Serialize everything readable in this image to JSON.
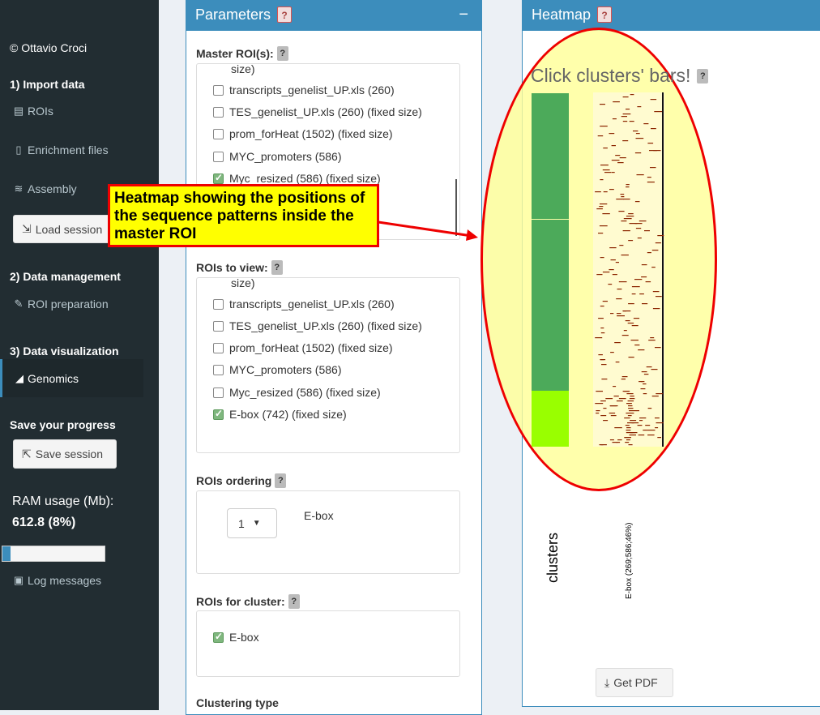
{
  "sidebar": {
    "copyright": "© Ottavio Croci",
    "section_import": "1) Import data",
    "item_rois": "ROIs",
    "item_enrichment": "Enrichment files",
    "item_assembly": "Assembly",
    "load_session": "Load session",
    "section_management": "2) Data management",
    "item_roi_preparation": "ROI preparation",
    "section_visualization": "3) Data visualization",
    "item_genomics": "Genomics",
    "save_progress": "Save your progress",
    "save_session": "Save session",
    "ram_label": "RAM usage (Mb):",
    "ram_value": "612.8 (8%)",
    "ram_percent": 8,
    "log_messages": "Log messages"
  },
  "parameters": {
    "title": "Parameters",
    "help": "?",
    "collapse": "−",
    "master_label": "Master ROI(s):",
    "master_cut": "size)",
    "master_items": [
      {
        "label": "transcripts_genelist_UP.xls (260)",
        "checked": false
      },
      {
        "label": "TES_genelist_UP.xls (260) (fixed size)",
        "checked": false
      },
      {
        "label": "prom_forHeat (1502) (fixed size)",
        "checked": false
      },
      {
        "label": "MYC_promoters (586)",
        "checked": false
      },
      {
        "label": "Myc_resized (586) (fixed size)",
        "checked": true
      }
    ],
    "view_label": "ROIs to view:",
    "view_cut": "size)",
    "view_items": [
      {
        "label": "transcripts_genelist_UP.xls (260)",
        "checked": false
      },
      {
        "label": "TES_genelist_UP.xls (260) (fixed size)",
        "checked": false
      },
      {
        "label": "prom_forHeat (1502) (fixed size)",
        "checked": false
      },
      {
        "label": "MYC_promoters (586)",
        "checked": false
      },
      {
        "label": "Myc_resized (586) (fixed size)",
        "checked": false
      },
      {
        "label": "E-box (742) (fixed size)",
        "checked": true
      }
    ],
    "ordering_label": "ROIs ordering",
    "ordering_value": "1",
    "ordering_roi": "E-box",
    "cluster_label": "ROIs for cluster:",
    "cluster_item": "E-box",
    "clustering_type_label": "Clustering type"
  },
  "heatmap": {
    "title": "Heatmap",
    "help": "?",
    "click_hint": "Click clusters' bars!",
    "clusters_label": "clusters",
    "column_label": "E-box (269;586;46%)",
    "get_pdf": "Get PDF",
    "cluster_colors": [
      "#4caa5a",
      "#4caa5a",
      "#99ff00"
    ]
  },
  "annotation": {
    "text": "Heatmap showing the positions of the sequence patterns inside the master ROI"
  }
}
